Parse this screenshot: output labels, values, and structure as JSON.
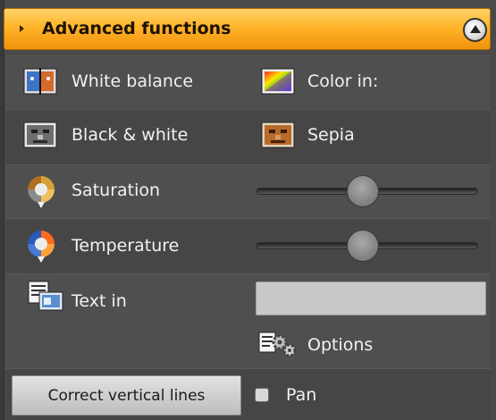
{
  "header": {
    "title": "Advanced functions"
  },
  "items": {
    "white_balance": "White balance",
    "color_in": "Color in:",
    "black_white": "Black & white",
    "sepia": "Sepia",
    "saturation": "Saturation",
    "temperature": "Temperature",
    "text_in": "Text in",
    "options": "Options"
  },
  "sliders": {
    "saturation_value": 0.48,
    "temperature_value": 0.48
  },
  "text_in_value": "",
  "buttons": {
    "correct_vertical": "Correct vertical lines"
  },
  "pan": {
    "label": "Pan",
    "checked": false
  },
  "icons": {
    "white_balance": "white-balance-icon",
    "color_in": "color-in-icon",
    "black_white": "black-white-icon",
    "sepia": "sepia-icon",
    "saturation": "saturation-icon",
    "temperature": "temperature-icon",
    "text_in": "text-in-icon",
    "options": "options-gear-icon"
  },
  "colors": {
    "header_accent": "#ffb42a",
    "panel_bg": "#4a4a4a"
  }
}
